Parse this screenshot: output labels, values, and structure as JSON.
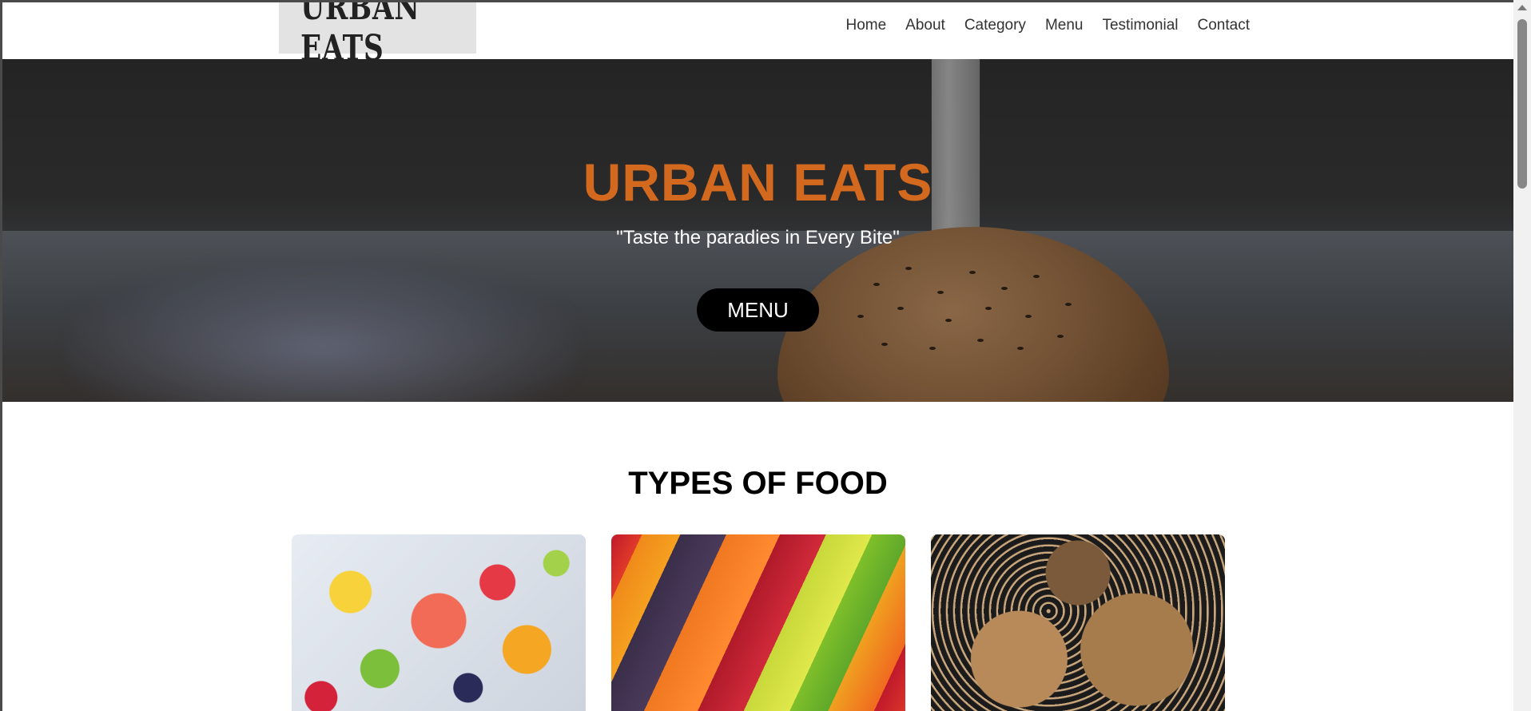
{
  "header": {
    "logo_text": "URBAN EATS",
    "nav": [
      "Home",
      "About",
      "Category",
      "Menu",
      "Testimonial",
      "Contact"
    ]
  },
  "hero": {
    "title": "URBAN EATS",
    "tagline": "\"Taste the paradies in Every Bite\"",
    "button_label": "MENU",
    "title_color": "#d2691e"
  },
  "types_section": {
    "title": "TYPES OF FOOD",
    "cards": [
      {
        "image": "fruit-platter-image"
      },
      {
        "image": "vegetable-rows-image"
      },
      {
        "image": "grains-legumes-image"
      }
    ]
  }
}
